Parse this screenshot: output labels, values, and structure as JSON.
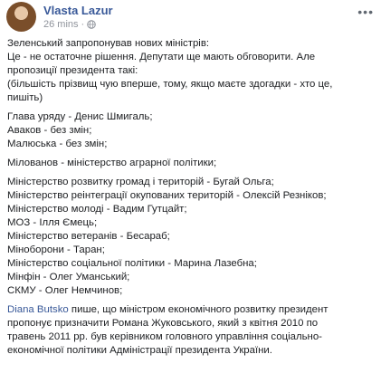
{
  "post": {
    "author": "Vlasta Lazur",
    "time": "26 mins",
    "icons": {
      "privacy": "globe-icon",
      "options": "more-options-icon"
    },
    "colors": {
      "name": "#385898",
      "text": "#1c1e21",
      "meta": "#90949c"
    },
    "intro": [
      "Зеленський запропонував нових міністрів:",
      "Це - не остаточне рішення. Депутати ще мають обговорити. Але",
      "пропозиції президента такі:",
      "(більшість прізвищ чую вперше, тому, якщо маєте здогадки - хто це,",
      "пишіть)"
    ],
    "group1": [
      "Глава уряду - Денис Шмигаль;",
      "Аваков - без змін;",
      "Малюська - без змін;"
    ],
    "group2": [
      "Мілованов - міністерство аграрної політики;"
    ],
    "group3": [
      "Міністерство розвитку громад і територій - Бугай Ольга;",
      "Міністерство реінтеграції окупованих територій - Олексій Резніков;",
      "Міністерство молоді - Вадим Гутцайт;",
      "МОЗ - Ілля Ємець;",
      "Міністерство ветеранів - Бесараб;",
      "Міноборони - Таран;",
      "Міністерство соціальної політики - Марина Лазебна;",
      "Мінфін - Олег Уманський;",
      "СКМУ - Олег Немчинов;"
    ],
    "closing": {
      "mention": "Diana Butsko",
      "first_rest": " пише, що міністром економічного розвитку президент",
      "lines": [
        "пропонує призначити Романа Жуковського, який з квітня 2010 по",
        "травень 2011 рр. був керівником головного управління соціально-",
        "економічної політики Адміністрації президента України."
      ]
    }
  }
}
